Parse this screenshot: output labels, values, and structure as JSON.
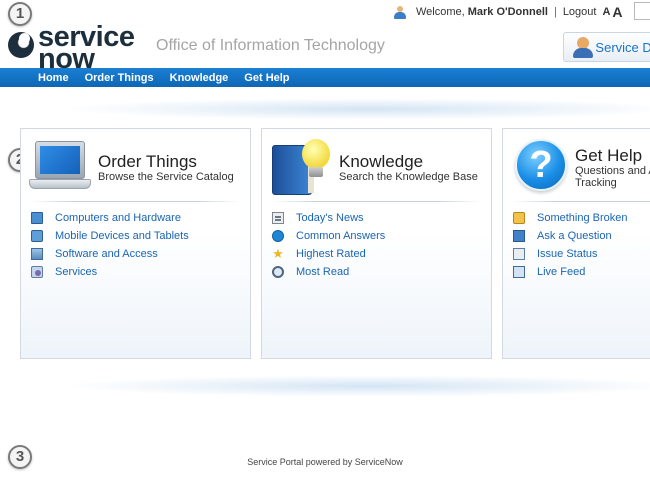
{
  "callouts": [
    "1",
    "2",
    "3"
  ],
  "header": {
    "logo_line1": "service",
    "logo_line2": "now",
    "site_title": "Office of Information Technology",
    "welcome_prefix": "Welcome,",
    "user_name": "Mark O'Donnell",
    "separator": "|",
    "logout": "Logout",
    "font_small": "A",
    "font_large": "A",
    "service_desk_label": "Service Desk"
  },
  "nav": {
    "items": [
      "Home",
      "Order Things",
      "Knowledge",
      "Get Help"
    ]
  },
  "cards": [
    {
      "title": "Order Things",
      "subtitle": "Browse the Service Catalog",
      "icon": "laptop-icon",
      "links": [
        {
          "label": "Computers and Hardware",
          "icon": "monitor-icon"
        },
        {
          "label": "Mobile Devices and Tablets",
          "icon": "mobile-device-icon"
        },
        {
          "label": "Software and Access",
          "icon": "software-icon"
        },
        {
          "label": "Services",
          "icon": "services-icon"
        }
      ]
    },
    {
      "title": "Knowledge",
      "subtitle": "Search the Knowledge Base",
      "icon": "book-lightbulb-icon",
      "links": [
        {
          "label": "Today's News",
          "icon": "newspaper-icon"
        },
        {
          "label": "Common Answers",
          "icon": "info-icon"
        },
        {
          "label": "Highest Rated",
          "icon": "star-icon"
        },
        {
          "label": "Most Read",
          "icon": "magnifier-icon"
        }
      ]
    },
    {
      "title": "Get Help",
      "subtitle_line1": "Questions and Answers",
      "subtitle_line2": "Tracking",
      "icon": "question-mark-icon",
      "links": [
        {
          "label": "Something Broken",
          "icon": "broken-icon"
        },
        {
          "label": "Ask a Question",
          "icon": "ask-icon"
        },
        {
          "label": "Issue Status",
          "icon": "issue-status-icon"
        },
        {
          "label": "Live Feed",
          "icon": "live-feed-icon"
        }
      ]
    }
  ],
  "footer": {
    "text": "Service Portal powered by ServiceNow"
  },
  "colors": {
    "nav_blue": "#1272c4",
    "link_blue": "#1a65b5",
    "brand_dark": "#1d2f3c"
  }
}
